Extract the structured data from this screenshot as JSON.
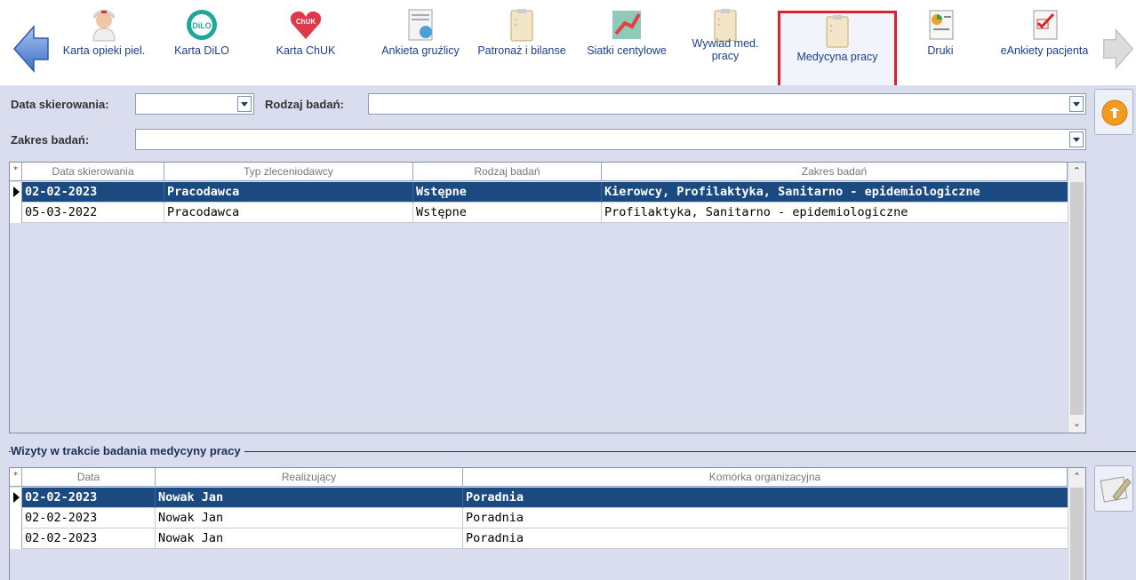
{
  "toolbar": {
    "items": [
      {
        "label": "Karta opieki piel.",
        "icon": "nurse-icon"
      },
      {
        "label": "Karta DiLO",
        "icon": "dilo-icon",
        "badge": "DiLO"
      },
      {
        "label": "Karta ChUK",
        "icon": "heart-icon",
        "badge": "ChUK"
      },
      {
        "label": "Ankieta gruźlicy",
        "icon": "form-icon"
      },
      {
        "label": "Patronaż i bilanse",
        "icon": "clipboard-icon"
      },
      {
        "label": "Siatki centylowe",
        "icon": "chart-icon"
      },
      {
        "label": "Wywiad med. pracy",
        "icon": "clipboard-icon"
      },
      {
        "label": "Medycyna pracy",
        "icon": "clipboard-icon"
      },
      {
        "label": "Druki",
        "icon": "document-icon"
      },
      {
        "label": "eAnkiety pacjenta",
        "icon": "checklist-icon"
      }
    ],
    "active_index": 7
  },
  "filters": {
    "data_skierowania_label": "Data skierowania:",
    "data_skierowania_value": "",
    "rodzaj_badan_label": "Rodzaj badań:",
    "rodzaj_badan_value": "",
    "zakres_badan_label": "Zakres badań:",
    "zakres_badan_value": ""
  },
  "referrals": {
    "star": "*",
    "columns": [
      "Data skierowania",
      "Typ zleceniodawcy",
      "Rodzaj badań",
      "Zakres badań"
    ],
    "rows": [
      [
        "02-02-2023",
        "Pracodawca",
        "Wstępne",
        "Kierowcy, Profilaktyka, Sanitarno - epidemiologiczne"
      ],
      [
        "05-03-2022",
        "Pracodawca",
        "Wstępne",
        "Profilaktyka, Sanitarno - epidemiologiczne"
      ]
    ],
    "selected_row": 0
  },
  "visits": {
    "section_title": "Wizyty w trakcie badania medycyny pracy",
    "star": "*",
    "columns": [
      "Data",
      "Realizujący",
      "Komórka organizacyjna"
    ],
    "rows": [
      [
        "02-02-2023",
        "Nowak Jan",
        "Poradnia"
      ],
      [
        "02-02-2023",
        "Nowak Jan",
        "Poradnia"
      ],
      [
        "02-02-2023",
        "Nowak Jan",
        "Poradnia"
      ]
    ],
    "selected_row": 0
  },
  "colors": {
    "selection": "#1a4a80",
    "panel": "#d9ddee",
    "highlight_border": "#e0202a",
    "toolbar_text": "#1a3f8f"
  }
}
